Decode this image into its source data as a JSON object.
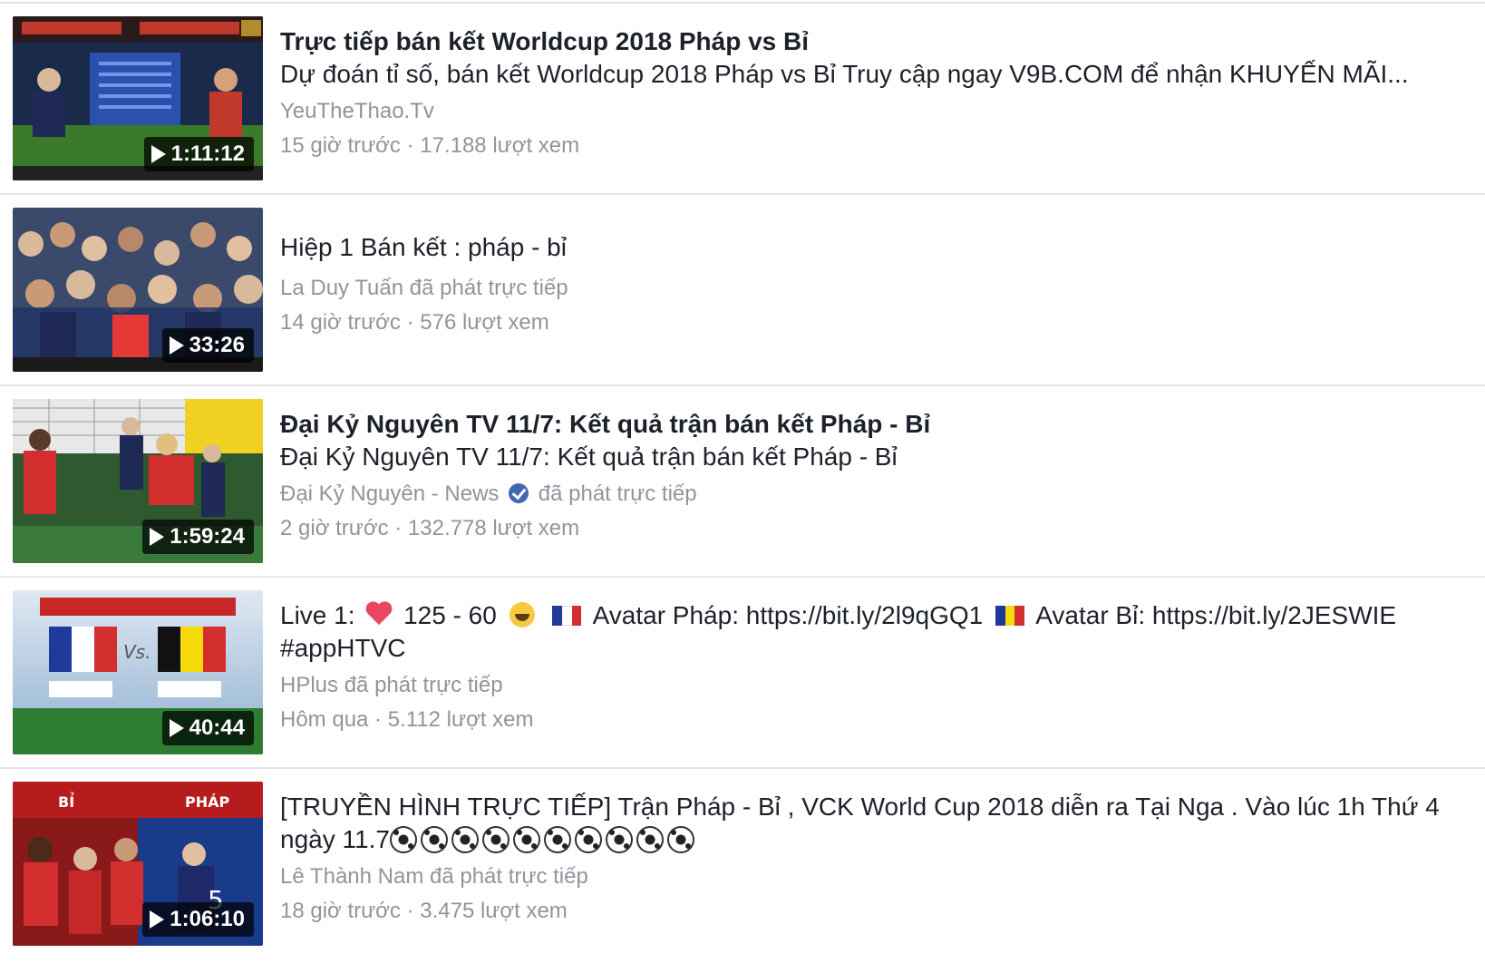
{
  "results": [
    {
      "title": "Trực tiếp bán kết Worldcup 2018 Pháp vs Bỉ",
      "description": "Dự đoán tỉ số, bán kết Worldcup 2018 Pháp vs Bỉ Truy cập ngay V9B.COM để nhận KHUYẾN MÃI...",
      "source": "YeuTheThao.Tv",
      "time": "15 giờ trước",
      "views": "17.188 lượt xem",
      "duration": "1:11:12",
      "thumb_icon": "video-thumbnail"
    },
    {
      "title": "Hiệp 1 Bán kết : pháp - bỉ",
      "source": "La Duy Tuấn",
      "source_suffix": "đã phát trực tiếp",
      "time": "14 giờ trước",
      "views": "576 lượt xem",
      "duration": "33:26"
    },
    {
      "title": "Đại Kỷ Nguyên TV 11/7: Kết quả trận bán kết Pháp - Bỉ",
      "description": "Đại Kỷ Nguyên TV 11/7: Kết quả trận bán kết Pháp - Bỉ",
      "source": "Đại Kỷ Nguyên - News",
      "source_suffix": "đã phát trực tiếp",
      "verified_icon": "verified-badge-icon",
      "time": "2 giờ trước",
      "views": "132.778 lượt xem",
      "duration": "1:59:24"
    },
    {
      "title_part1": "Live 1:",
      "title_part2": "125 - 60",
      "title_part3": "Avatar Pháp: https://bit.ly/2l9qGQ1",
      "title_part4": "Avatar Bỉ: https://bit.ly/2JESWIE",
      "title_line2": "#appHTVC",
      "source": "HPlus",
      "source_suffix": "đã phát trực tiếp",
      "time": "Hôm qua",
      "views": "5.112 lượt xem",
      "duration": "40:44"
    },
    {
      "title_line1": "[TRUYỀN HÌNH TRỰC TIẾP] Trận Pháp - Bỉ , VCK World Cup 2018 diễn ra Tại Nga . Vào lúc 1h Thứ 4",
      "title_line2": "ngày 11.7",
      "ball_count": 10,
      "source": "Lê Thành Nam",
      "source_suffix": "đã phát trực tiếp",
      "time": "18 giờ trước",
      "views": "3.475 lượt xem",
      "duration": "1:06:10"
    }
  ],
  "separator": " · ",
  "colors": {
    "text": "#1d2129",
    "meta": "#90949c",
    "divider": "#e5e6e9",
    "verified": "#4267b2"
  }
}
